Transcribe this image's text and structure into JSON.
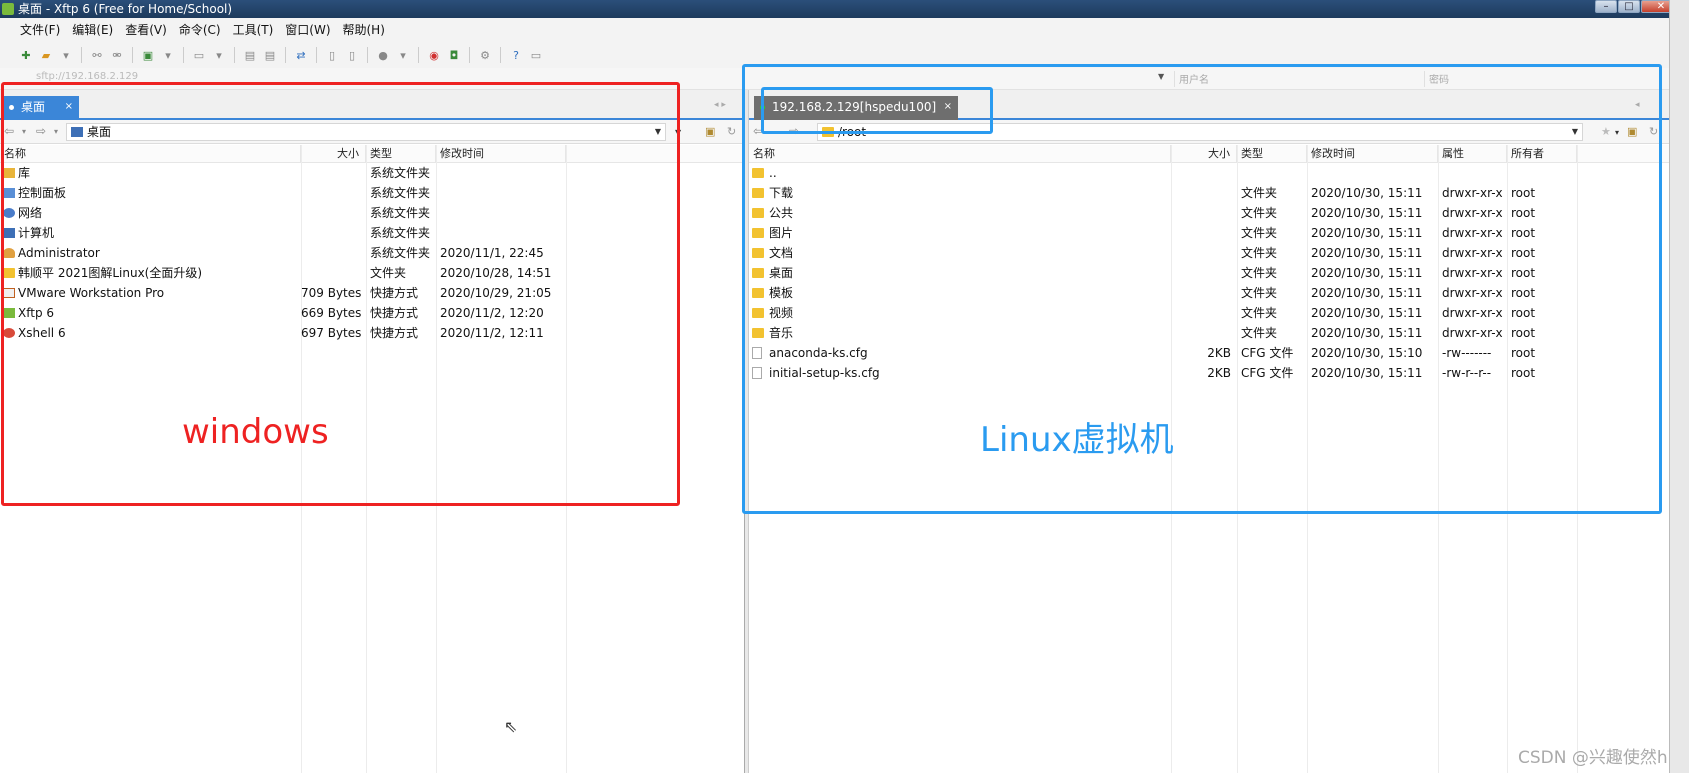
{
  "window": {
    "title": "桌面 - Xftp 6 (Free for Home/School)",
    "min_label": "–",
    "max_label": "□",
    "close_label": "✕"
  },
  "menu": [
    "文件(F)",
    "编辑(E)",
    "查看(V)",
    "命令(C)",
    "工具(T)",
    "窗口(W)",
    "帮助(H)"
  ],
  "toolbar": {
    "icons": [
      "new-session-icon",
      "open-folder-icon",
      "dropdown-icon",
      "connect-icon",
      "disconnect-icon",
      "new-tab-icon",
      "dropdown-icon",
      "log-icon",
      "dropdown-icon",
      "copy-icon",
      "paste-icon",
      "transfer-icon",
      "file-icon",
      "file-icon",
      "record-icon",
      "dropdown-icon",
      "xshell-icon",
      "xftp-icon",
      "gear-icon",
      "help-icon",
      "chat-icon"
    ]
  },
  "address": {
    "host_placeholder": "sftp://192.168.2.129",
    "user_placeholder": "用户名",
    "pass_placeholder": "密码"
  },
  "left": {
    "tab_label": "桌面",
    "tab_close": "×",
    "path": "桌面",
    "columns": {
      "name": "名称",
      "size": "大小",
      "type": "类型",
      "mtime": "修改时间"
    },
    "rows": [
      {
        "icon": "library-icon",
        "name": "库",
        "size": "",
        "type": "系统文件夹",
        "mtime": ""
      },
      {
        "icon": "control-panel-icon",
        "name": "控制面板",
        "size": "",
        "type": "系统文件夹",
        "mtime": ""
      },
      {
        "icon": "network-icon",
        "name": "网络",
        "size": "",
        "type": "系统文件夹",
        "mtime": ""
      },
      {
        "icon": "computer-icon",
        "name": "计算机",
        "size": "",
        "type": "系统文件夹",
        "mtime": ""
      },
      {
        "icon": "user-folder-icon",
        "name": "Administrator",
        "size": "",
        "type": "系统文件夹",
        "mtime": "2020/11/1, 22:45"
      },
      {
        "icon": "folder-icon",
        "name": "韩顺平 2021图解Linux(全面升级)",
        "size": "",
        "type": "文件夹",
        "mtime": "2020/10/28, 14:51"
      },
      {
        "icon": "vmware-icon",
        "name": "VMware Workstation Pro",
        "size": "709 Bytes",
        "type": "快捷方式",
        "mtime": "2020/10/29, 21:05"
      },
      {
        "icon": "xftp-icon",
        "name": "Xftp 6",
        "size": "669 Bytes",
        "type": "快捷方式",
        "mtime": "2020/11/2, 12:20"
      },
      {
        "icon": "xshell-icon",
        "name": "Xshell 6",
        "size": "697 Bytes",
        "type": "快捷方式",
        "mtime": "2020/11/2, 12:11"
      }
    ]
  },
  "right": {
    "tab_label": "192.168.2.129[hspedu100]",
    "tab_close": "×",
    "path": "/root",
    "columns": {
      "name": "名称",
      "size": "大小",
      "type": "类型",
      "mtime": "修改时间",
      "attr": "属性",
      "owner": "所有者"
    },
    "rows": [
      {
        "icon": "folder-icon",
        "name": "..",
        "size": "",
        "type": "",
        "mtime": "",
        "attr": "",
        "owner": ""
      },
      {
        "icon": "folder-icon",
        "name": "下载",
        "size": "",
        "type": "文件夹",
        "mtime": "2020/10/30, 15:11",
        "attr": "drwxr-xr-x",
        "owner": "root"
      },
      {
        "icon": "folder-icon",
        "name": "公共",
        "size": "",
        "type": "文件夹",
        "mtime": "2020/10/30, 15:11",
        "attr": "drwxr-xr-x",
        "owner": "root"
      },
      {
        "icon": "folder-icon",
        "name": "图片",
        "size": "",
        "type": "文件夹",
        "mtime": "2020/10/30, 15:11",
        "attr": "drwxr-xr-x",
        "owner": "root"
      },
      {
        "icon": "folder-icon",
        "name": "文档",
        "size": "",
        "type": "文件夹",
        "mtime": "2020/10/30, 15:11",
        "attr": "drwxr-xr-x",
        "owner": "root"
      },
      {
        "icon": "folder-icon",
        "name": "桌面",
        "size": "",
        "type": "文件夹",
        "mtime": "2020/10/30, 15:11",
        "attr": "drwxr-xr-x",
        "owner": "root"
      },
      {
        "icon": "folder-icon",
        "name": "模板",
        "size": "",
        "type": "文件夹",
        "mtime": "2020/10/30, 15:11",
        "attr": "drwxr-xr-x",
        "owner": "root"
      },
      {
        "icon": "folder-icon",
        "name": "视频",
        "size": "",
        "type": "文件夹",
        "mtime": "2020/10/30, 15:11",
        "attr": "drwxr-xr-x",
        "owner": "root"
      },
      {
        "icon": "folder-icon",
        "name": "音乐",
        "size": "",
        "type": "文件夹",
        "mtime": "2020/10/30, 15:11",
        "attr": "drwxr-xr-x",
        "owner": "root"
      },
      {
        "icon": "file-icon",
        "name": "anaconda-ks.cfg",
        "size": "2KB",
        "type": "CFG 文件",
        "mtime": "2020/10/30, 15:10",
        "attr": "-rw-------",
        "owner": "root"
      },
      {
        "icon": "file-icon",
        "name": "initial-setup-ks.cfg",
        "size": "2KB",
        "type": "CFG 文件",
        "mtime": "2020/10/30, 15:11",
        "attr": "-rw-r--r--",
        "owner": "root"
      }
    ]
  },
  "annotations": {
    "windows_label": "windows",
    "linux_label": "Linux虚拟机",
    "red_color": "#ee2222",
    "blue_color": "#2a9bf0"
  },
  "watermark": "CSDN @兴趣使然h"
}
